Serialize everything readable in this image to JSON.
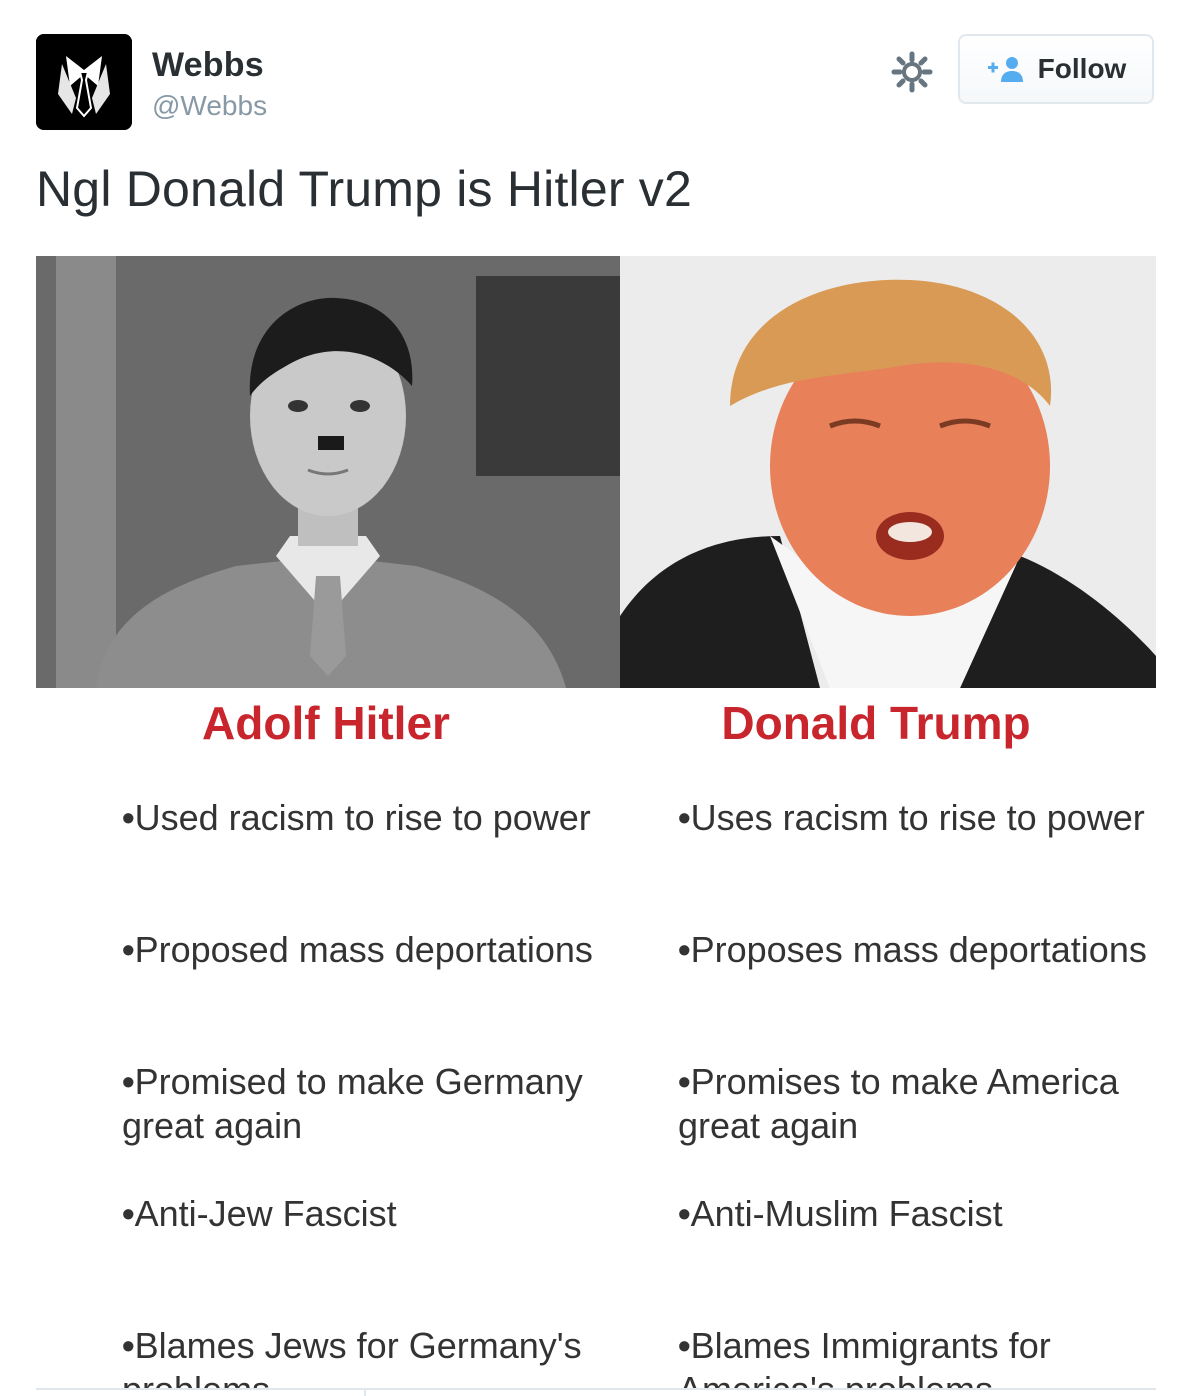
{
  "author": {
    "display_name": "Webbs",
    "handle": "@Webbs",
    "avatar_icon": "suit-tie-avatar-icon"
  },
  "actions": {
    "settings_icon": "gear-icon",
    "follow_icon": "add-user-icon",
    "follow_label": "Follow"
  },
  "tweet": {
    "text": "Ngl Donald Trump is Hitler v2"
  },
  "media": {
    "columns": [
      {
        "name": "Adolf Hitler",
        "points": [
          "Used racism to rise to power",
          "Proposed mass deportations",
          "Promised to make Germany great again",
          "Anti-Jew Fascist",
          "Blames Jews for Germany's problems"
        ]
      },
      {
        "name": "Donald Trump",
        "points": [
          "Uses racism to rise to power",
          "Proposes mass deportations",
          "Promises to make America great again",
          "Anti-Muslim Fascist",
          "Blames Immigrants for America's problems"
        ]
      }
    ],
    "bullet": "•"
  },
  "colors": {
    "heading_red": "#c8252c",
    "follow_blue": "#55acee",
    "muted": "#8899a6"
  }
}
